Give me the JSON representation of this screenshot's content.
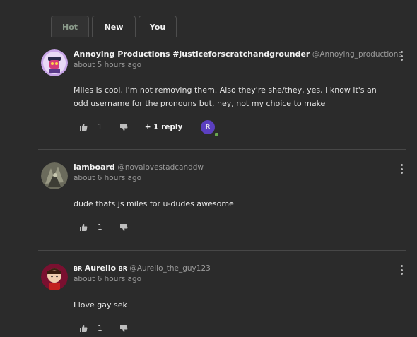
{
  "tabs": [
    {
      "label": "Hot",
      "active": true
    },
    {
      "label": "New",
      "active": false
    },
    {
      "label": "You",
      "active": false
    }
  ],
  "comments": [
    {
      "author": "Annoying Productions #justiceforscratchandgrounder",
      "handle": "@Annoying_productions",
      "time": "about 5 hours ago",
      "text": "Miles is cool, I'm not removing them. Also they're she/they, yes, I know it's an odd username for the pronouns but, hey, not my choice to make",
      "likes": "1",
      "reply_label": "+ 1 reply",
      "reply_avatar_letter": "R"
    },
    {
      "author": "iamboard",
      "handle": "@novalovestadcanddw",
      "time": "about 6 hours ago",
      "text": "dude thats js miles for u-dudes awesome",
      "likes": "1"
    },
    {
      "author_prefix": "BR",
      "author": "Aurelio",
      "author_suffix": "BR",
      "handle": "@Aurelio_the_guy123",
      "time": "about 6 hours ago",
      "text": "I love gay sek",
      "likes": "1"
    }
  ],
  "colors": {
    "background": "#2b2b2b",
    "active_tab_text": "#8a9a8a",
    "reply_avatar": "#5b3fc0"
  },
  "icons": {
    "like": "thumbs-up-icon",
    "dislike": "thumbs-down-icon",
    "menu": "kebab-menu-icon"
  }
}
